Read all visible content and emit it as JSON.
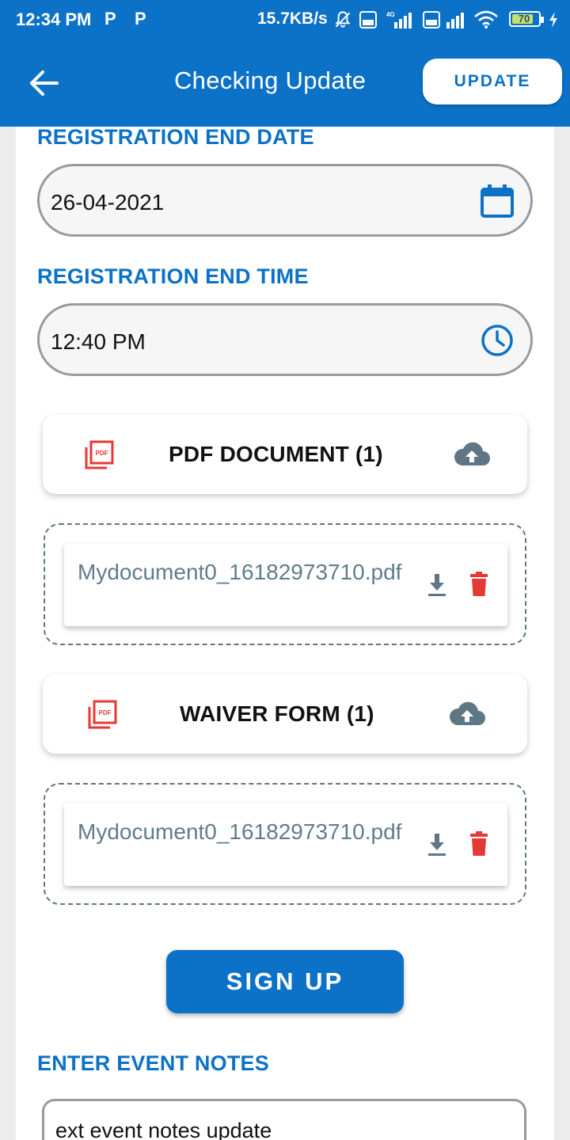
{
  "status_bar": {
    "time": "12:34 PM",
    "notif_1": "P",
    "notif_2": "P",
    "net_speed": "15.7KB/s",
    "battery_level": "70",
    "icons": [
      "mute-bell-icon",
      "volte-icon",
      "signal-4g-icon",
      "volte-icon",
      "signal-icon",
      "wifi-icon",
      "battery-icon",
      "charging-icon"
    ]
  },
  "app_bar": {
    "title": "Checking Update",
    "update_label": "UPDATE"
  },
  "form": {
    "end_date_label": "REGISTRATION END DATE",
    "end_date_value": "26-04-2021",
    "end_time_label": "REGISTRATION END TIME",
    "end_time_value": "12:40 PM",
    "pdf_document": {
      "title": "PDF DOCUMENT (1)",
      "file_name": "Mydocument0_16182973710.pdf"
    },
    "waiver_form": {
      "title": "WAIVER FORM (1)",
      "file_name": "Mydocument0_16182973710.pdf"
    },
    "signup_label": "SIGN UP",
    "notes_label": "ENTER EVENT NOTES",
    "notes_value": "ext event notes update"
  },
  "colors": {
    "primary": "#0b72c8",
    "file_text": "#607d8b",
    "pdf_red": "#e53935",
    "upload_gray": "#5f7785"
  }
}
